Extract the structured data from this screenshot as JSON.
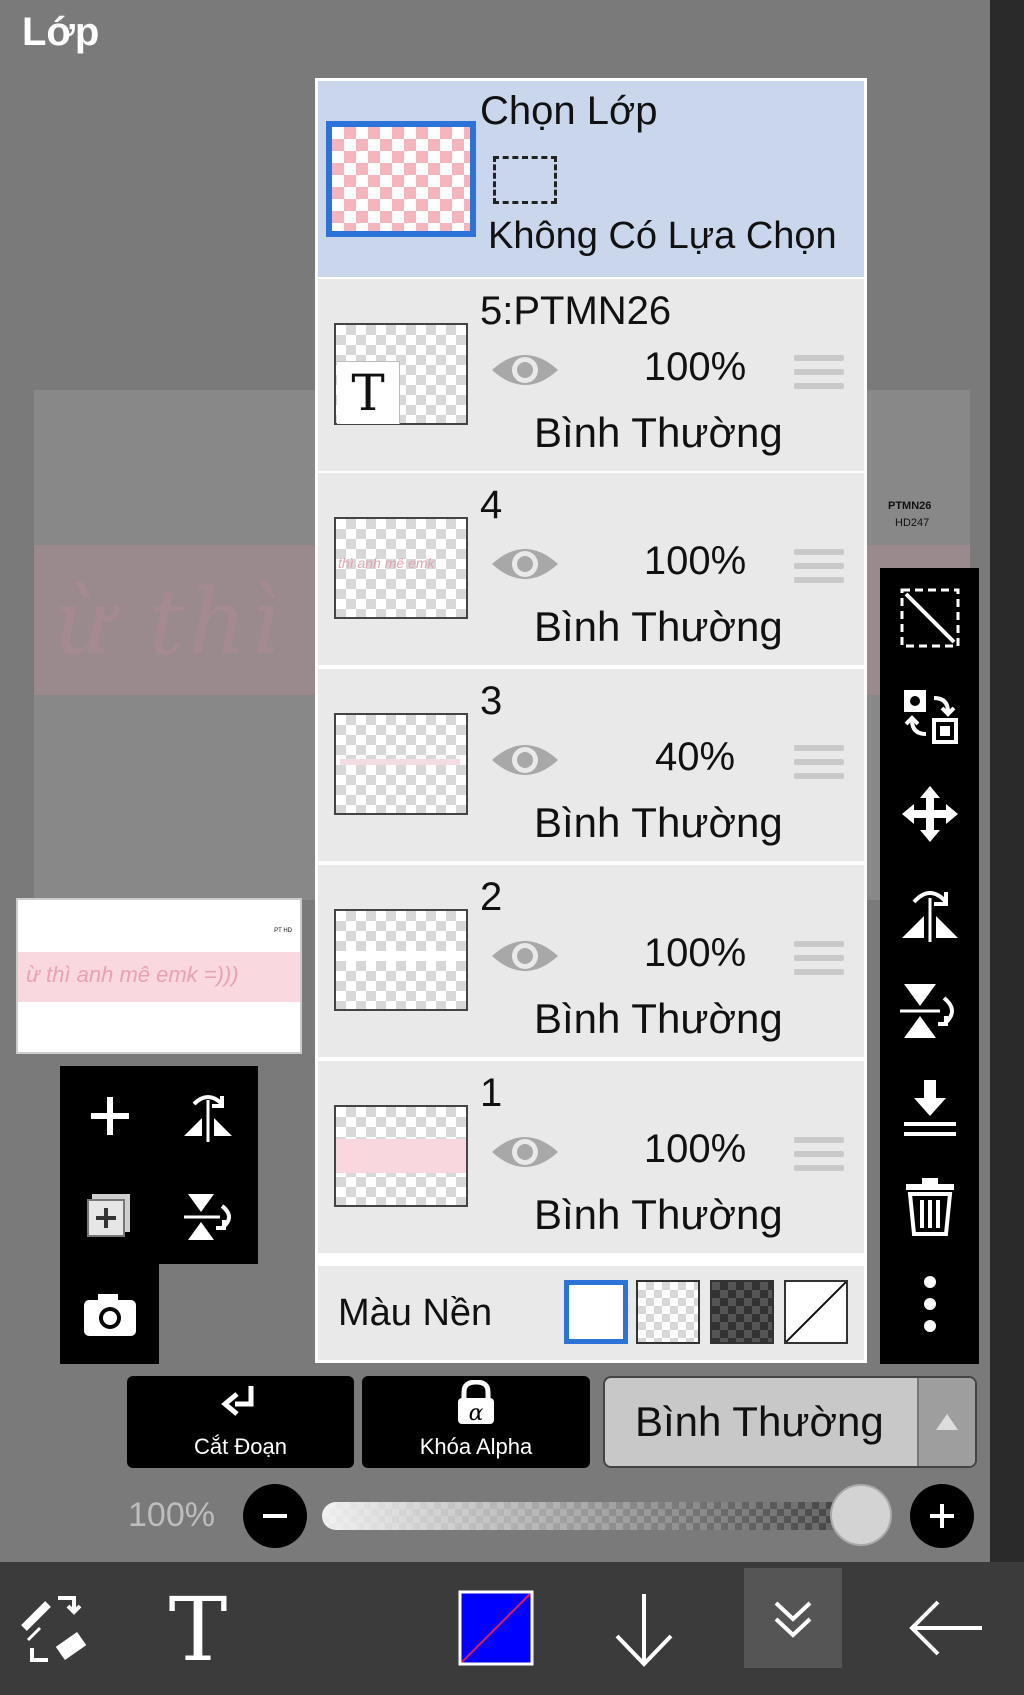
{
  "header": {
    "title": "Lớp"
  },
  "canvas": {
    "text": "ừ thì",
    "mark_line1": "PTMN26",
    "mark_line2": "HD247"
  },
  "preview": {
    "text": "ừ thì anh mê emk =)))",
    "mark": "PT HD"
  },
  "selection": {
    "title": "Chọn Lớp",
    "subtitle": "Không Có Lựa Chọn"
  },
  "layers": [
    {
      "name": "5:PTMN26",
      "opacity": "100%",
      "mode": "Bình Thường",
      "kind": "text",
      "thumb_text": "T"
    },
    {
      "name": "4",
      "opacity": "100%",
      "mode": "Bình Thường",
      "kind": "text-art",
      "thumb_text": "thì anh mê emk"
    },
    {
      "name": "3",
      "opacity": "40%",
      "mode": "Bình Thường",
      "kind": "faint"
    },
    {
      "name": "2",
      "opacity": "100%",
      "mode": "Bình Thường",
      "kind": "white"
    },
    {
      "name": "1",
      "opacity": "100%",
      "mode": "Bình Thường",
      "kind": "pink-band"
    }
  ],
  "background": {
    "label": "Màu Nền",
    "swatches": [
      "white",
      "checker-light",
      "checker-dark",
      "none"
    ],
    "selected": 0
  },
  "actions": {
    "clip_label": "Cắt Đoạn",
    "alpha_lock_label": "Khóa Alpha",
    "blend_mode": "Bình Thường"
  },
  "opacity": {
    "label": "100%",
    "value": 1.0
  },
  "colors": {
    "accent": "#2b73d8",
    "selection_bg": "#c9d6ec",
    "primary_color": "#0000ff"
  },
  "icons": {
    "right_toolbar": [
      "select-transform-icon",
      "swap-layer-icon",
      "move-icon",
      "flip-horizontal-icon",
      "flip-vertical-icon",
      "merge-down-icon",
      "trash-icon",
      "more-vertical-icon"
    ],
    "left_toolbar": [
      "add-layer-icon",
      "duplicate-layer-icon",
      "camera-icon",
      "flip-horizontal-icon",
      "flip-vertical-icon"
    ],
    "bottom_bar": [
      "tool-swap-icon",
      "text-tool-icon",
      "color-swatch-icon",
      "arrow-down-icon",
      "chevron-double-down-icon",
      "back-arrow-icon"
    ]
  }
}
